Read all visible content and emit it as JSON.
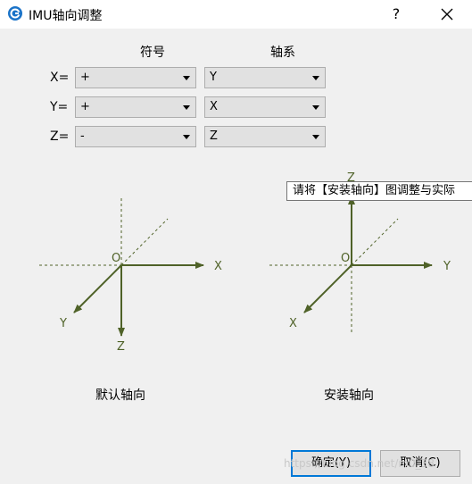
{
  "window": {
    "title": "IMU轴向调整",
    "help_glyph": "?"
  },
  "columns": {
    "sign_header": "符号",
    "axis_header": "轴系"
  },
  "rows": [
    {
      "label": "X=",
      "sign": "+",
      "axis": "Y"
    },
    {
      "label": "Y=",
      "sign": "+",
      "axis": "X"
    },
    {
      "label": "Z=",
      "sign": "-",
      "axis": "Z"
    }
  ],
  "default_diagram": {
    "origin": "O",
    "x": "X",
    "y": "Y",
    "z": "Z",
    "caption": "默认轴向"
  },
  "installed_diagram": {
    "origin": "O",
    "x": "X",
    "y": "Y",
    "z": "Z",
    "caption": "安装轴向"
  },
  "tooltip": "请将【安装轴向】图调整与实际",
  "buttons": {
    "ok": "确定(Y)",
    "cancel": "取消(C)"
  },
  "watermark": "https://blog.csdn.net/m0_38",
  "colors": {
    "axis": "#4f6228",
    "accent": "#0078d7",
    "app_icon": "#1a73c8"
  },
  "icons": {
    "app": "gear-g-icon",
    "help": "question-icon",
    "close": "close-icon",
    "dropdown": "chevron-down-icon"
  }
}
